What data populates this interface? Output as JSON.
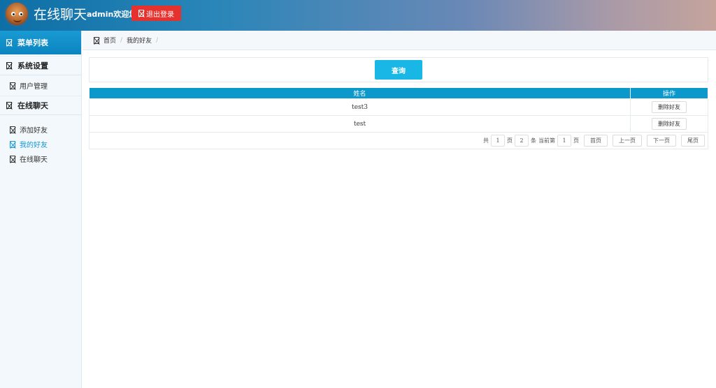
{
  "header": {
    "title": "在线聊天",
    "welcome": "admin欢迎您!",
    "logout_label": "退出登录"
  },
  "sidebar": {
    "menu_title": "菜单列表",
    "groups": [
      {
        "title": "系统设置",
        "items": [
          {
            "label": "用户管理"
          }
        ]
      },
      {
        "title": "在线聊天",
        "items": [
          {
            "label": "添加好友"
          },
          {
            "label": "我的好友"
          },
          {
            "label": "在线聊天"
          }
        ]
      }
    ],
    "active_item": "我的好友"
  },
  "breadcrumb": [
    "首页",
    "我的好友"
  ],
  "query": {
    "button_label": "查询"
  },
  "table": {
    "headers": [
      "姓名",
      "操作"
    ],
    "rows": [
      {
        "name": "test3",
        "action": "删除好友"
      },
      {
        "name": "test",
        "action": "删除好友"
      }
    ]
  },
  "pager": {
    "total_prefix": "共",
    "total_pages": "1",
    "pages_unit": "页",
    "total_items": "2",
    "items_unit": "条",
    "current_prefix": "当前第",
    "current_page": "1",
    "current_unit": "页",
    "first": "首页",
    "prev": "上一页",
    "next": "下一页",
    "last": "尾页"
  },
  "colors": {
    "accent": "#0b99cc",
    "query_button": "#19b7e6",
    "logout_button": "#e5322f",
    "active_link": "#1697d6"
  }
}
